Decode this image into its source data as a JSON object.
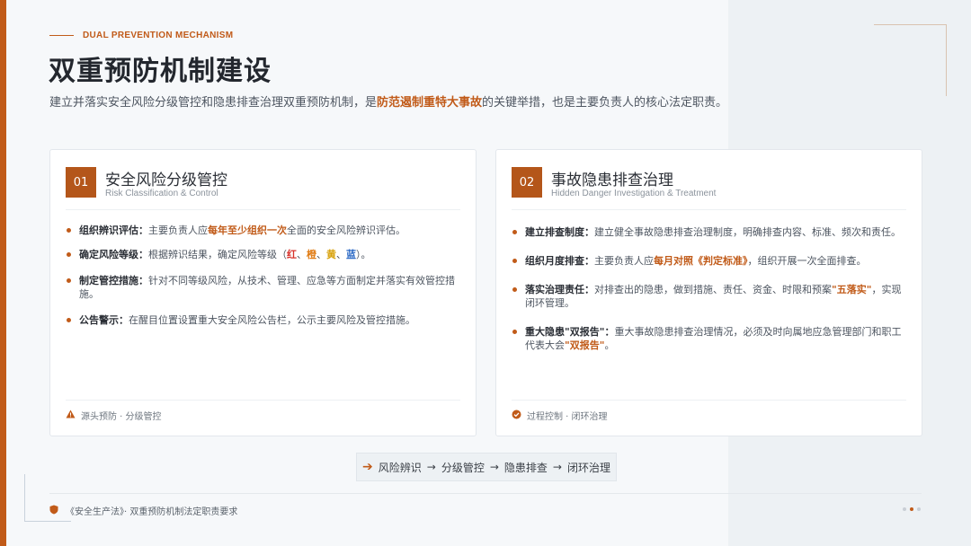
{
  "header": {
    "eyebrow": "DUAL PREVENTION MECHANISM",
    "title": "双重预防机制建设",
    "intro_before": "建立并落实安全风险分级管控和隐患排查治理双重预防机制，是",
    "intro_highlight": "防范遏制重特大事故",
    "intro_after": "的关键举措，也是主要负责人的核心法定职责。"
  },
  "cards": [
    {
      "number": "01",
      "title": "安全风险分级管控",
      "subtitle": "Risk Classification & Control",
      "items": [
        {
          "key": "组织辨识评估：",
          "text_before": "主要负责人应",
          "highlight": "每年至少组织一次",
          "text_after": "全面的安全风险辨识评估。"
        },
        {
          "key": "确定风险等级：",
          "text_before": "根据辨识结果，确定风险等级（",
          "c1": "红",
          "sep1": "、",
          "c2": "橙",
          "sep2": "、",
          "c3": "黄",
          "sep3": "、",
          "c4": "蓝",
          "text_after": "）。"
        },
        {
          "key": "制定管控措施：",
          "text": "针对不同等级风险，从技术、管理、应急等方面制定并落实有效管控措施。"
        },
        {
          "key": "公告警示：",
          "text": "在醒目位置设置重大安全风险公告栏，公示主要风险及管控措施。"
        }
      ],
      "footer": "源头预防 · 分级管控",
      "footer_icon": "warning-icon"
    },
    {
      "number": "02",
      "title": "事故隐患排查治理",
      "subtitle": "Hidden Danger Investigation & Treatment",
      "items": [
        {
          "key": "建立排查制度：",
          "text": "建立健全事故隐患排查治理制度，明确排查内容、标准、频次和责任。"
        },
        {
          "key": "组织月度排查：",
          "text_before": "主要负责人应",
          "highlight": "每月对照《判定标准》",
          "text_after": "，组织开展一次全面排查。"
        },
        {
          "key": "落实治理责任：",
          "text_before": "对排查出的隐患，做到措施、责任、资金、时限和预案",
          "highlight": "\"五落实\"",
          "text_after": "，实现闭环管理。"
        },
        {
          "key": "重大隐患\"双报告\"：",
          "text_before": "重大事故隐患排查治理情况，必须及时向属地应急管理部门和职工代表大会",
          "highlight": "\"双报告\"",
          "text_after": "。"
        }
      ],
      "footer": "过程控制 · 闭环治理",
      "footer_icon": "check-circle-icon"
    }
  ],
  "flow": {
    "arrow_icon": "arrow-right-icon",
    "steps": [
      "风险辨识",
      "分级管控",
      "隐患排查",
      "闭环治理"
    ],
    "separator": "→"
  },
  "footer": {
    "icon": "shield-icon",
    "text": "《安全生产法》· 双重预防机制法定职责要求"
  },
  "pagination": {
    "total": 3,
    "active": 2
  },
  "colors": {
    "accent": "#c15b19",
    "red": "#d7322b",
    "orange": "#e07b13",
    "yellow": "#d8a20d",
    "blue": "#2867c4"
  }
}
